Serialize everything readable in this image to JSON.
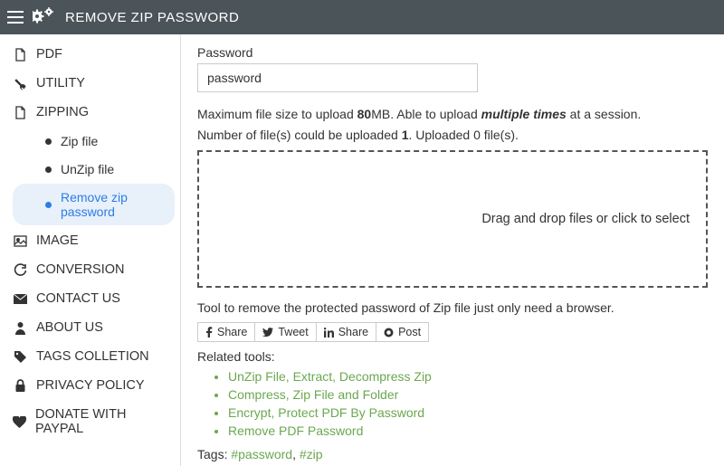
{
  "header": {
    "title": "REMOVE ZIP PASSWORD"
  },
  "sidebar": {
    "items": [
      {
        "label": "PDF",
        "icon": "file"
      },
      {
        "label": "UTILITY",
        "icon": "wrench"
      },
      {
        "label": "ZIPPING",
        "icon": "file",
        "sub": [
          {
            "label": "Zip file",
            "active": false
          },
          {
            "label": "UnZip file",
            "active": false
          },
          {
            "label": "Remove zip password",
            "active": true
          }
        ]
      },
      {
        "label": "IMAGE",
        "icon": "image"
      },
      {
        "label": "CONVERSION",
        "icon": "refresh"
      },
      {
        "label": "CONTACT US",
        "icon": "mail"
      },
      {
        "label": "ABOUT US",
        "icon": "user"
      },
      {
        "label": "TAGS COLLETION",
        "icon": "tag"
      },
      {
        "label": "PRIVACY POLICY",
        "icon": "lock"
      },
      {
        "label": "DONATE WITH PAYPAL",
        "icon": "heart"
      }
    ]
  },
  "content": {
    "password_label": "Password",
    "password_value": "password",
    "max_info_pre": "Maximum file size to upload ",
    "max_size": "80",
    "max_unit": "MB",
    "max_info_mid": ". Able to upload ",
    "max_emph": "multiple times",
    "max_info_post": " at a session.",
    "count_pre": "Number of file(s) could be uploaded ",
    "count_limit": "1",
    "count_mid": ". Uploaded ",
    "count_uploaded": "0",
    "count_post": " file(s).",
    "dropzone_text": "Drag and drop files or click to select",
    "description": "Tool to remove the protected password of Zip file just only need a browser.",
    "share": {
      "share": "Share",
      "tweet": "Tweet",
      "linkedin": "Share",
      "post": "Post"
    },
    "related_title": "Related tools:",
    "related": [
      "UnZip File, Extract, Decompress Zip",
      "Compress, Zip File and Folder",
      "Encrypt, Protect PDF By Password",
      "Remove PDF Password"
    ],
    "tags_label": "Tags: ",
    "tags": [
      "#password",
      "#zip"
    ]
  }
}
